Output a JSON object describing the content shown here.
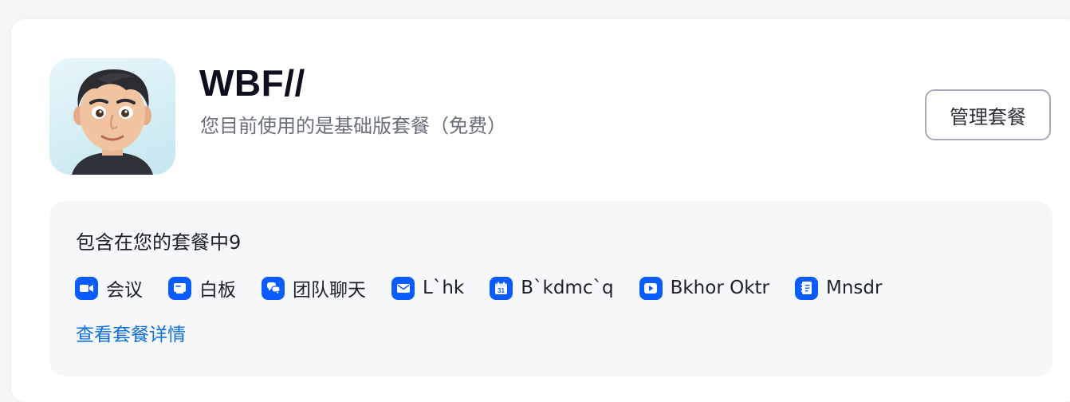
{
  "user": {
    "name": "WBF//",
    "plan_description": "您目前使用的是基础版套餐（免费）"
  },
  "actions": {
    "manage_label": "管理套餐"
  },
  "plan_panel": {
    "title": "包含在您的套餐中9",
    "details_link": "查看套餐详情",
    "features": [
      {
        "label": "会议",
        "icon": "video-camera-icon"
      },
      {
        "label": "白板",
        "icon": "whiteboard-icon"
      },
      {
        "label": "团队聊天",
        "icon": "chat-bubbles-icon"
      },
      {
        "label": "L`hk",
        "icon": "mail-icon"
      },
      {
        "label": "B`kdmc`q",
        "icon": "calendar-icon"
      },
      {
        "label": "Bkhor Oktr",
        "icon": "clips-play-icon"
      },
      {
        "label": "Mnsdr",
        "icon": "notes-icon"
      }
    ]
  },
  "colors": {
    "accent": "#0b5cff",
    "link": "#0e6fe0"
  }
}
